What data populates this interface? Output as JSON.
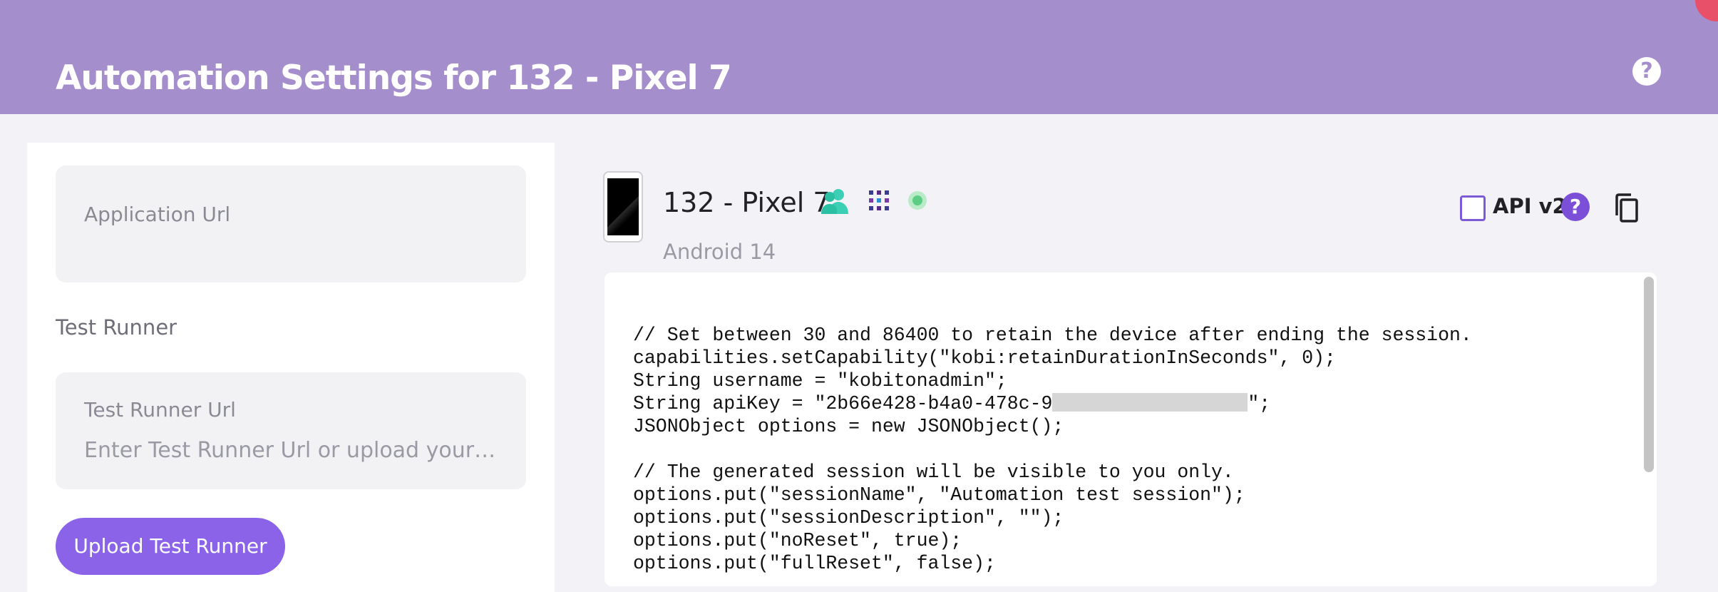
{
  "header": {
    "title": "Automation Settings for 132 - Pixel 7",
    "help_icon": "help-circle-icon",
    "help_glyph": "?",
    "background_color": "#a58ecc"
  },
  "left_panel": {
    "app_url_label": "Application Url",
    "test_runner_section_label": "Test Runner",
    "test_runner_url_label": "Test Runner Url",
    "test_runner_url_placeholder": "Enter Test Runner Url or upload your Test Runner",
    "upload_button_label": "Upload Test Runner",
    "button_color": "#8b63e8"
  },
  "device": {
    "name": "132 - Pixel 7",
    "os": "Android 14",
    "icons": [
      "users-icon",
      "grid-icon",
      "status-online-icon"
    ]
  },
  "api_toggle": {
    "label": "API v2",
    "checked": false,
    "help_glyph": "?"
  },
  "code": {
    "lines": [
      "// Set between 30 and 86400 to retain the device after ending the session.",
      "capabilities.setCapability(\"kobi:retainDurationInSeconds\", 0);",
      "String username = \"kobitonadmin\";",
      "String apiKey = \"2b66e428-b4a0-478c-9",
      "JSONObject options = new JSONObject();",
      "",
      "// The generated session will be visible to you only.",
      "options.put(\"sessionName\", \"Automation test session\");",
      "options.put(\"sessionDescription\", \"\");",
      "options.put(\"noReset\", true);",
      "options.put(\"fullReset\", false);"
    ],
    "apikey_suffix": "\";"
  }
}
